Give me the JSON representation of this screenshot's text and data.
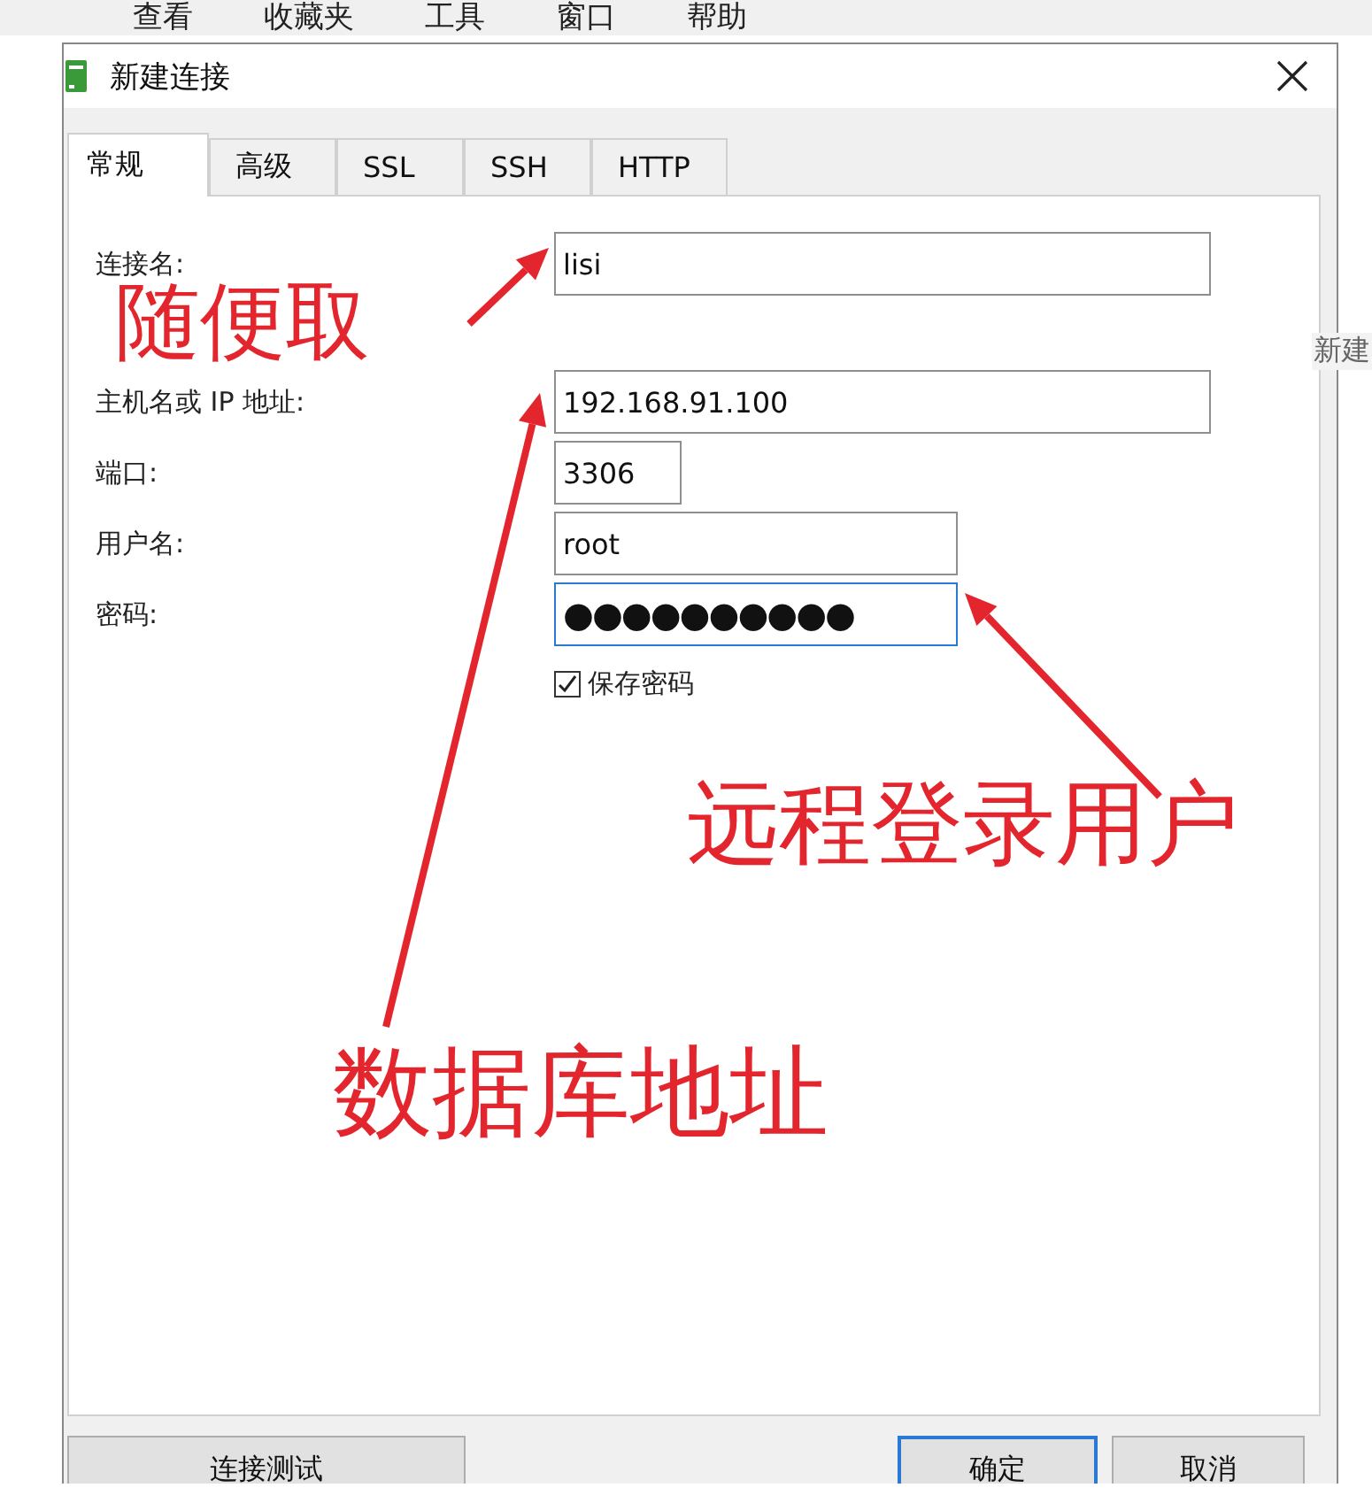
{
  "menu_bar": [
    {
      "label": "查看"
    },
    {
      "label": "收藏夹"
    },
    {
      "label": "工具"
    },
    {
      "label": "窗口"
    },
    {
      "label": "帮助"
    }
  ],
  "background_text": "新建",
  "dialog": {
    "title": "新建连接",
    "tabs": [
      {
        "label": "常规",
        "selected": true
      },
      {
        "label": "高级",
        "selected": false
      },
      {
        "label": "SSL",
        "selected": false
      },
      {
        "label": "SSH",
        "selected": false
      },
      {
        "label": "HTTP",
        "selected": false
      }
    ],
    "connection_name": {
      "label": "连接名:",
      "value": "lisi"
    },
    "fields": [
      {
        "label": "主机名或 IP 地址:",
        "value": "192.168.91.100",
        "kind": "text",
        "focused": false
      },
      {
        "label": "端口:",
        "value": "3306",
        "kind": "number",
        "focused": false
      },
      {
        "label": "用户名:",
        "value": "root",
        "kind": "user",
        "focused": false
      },
      {
        "label": "密码:",
        "value": "●●●●●●●●●●",
        "kind": "password",
        "focused": true
      }
    ],
    "save_password": {
      "label": "保存密码",
      "checked": true
    },
    "buttons": [
      {
        "label": "连接测试",
        "default": false
      },
      {
        "label": "确定",
        "default": true
      },
      {
        "label": "取消",
        "default": false
      }
    ]
  },
  "annotations": [
    {
      "text": "随便取"
    },
    {
      "text": "远程登录用户"
    },
    {
      "text": "数据库地址"
    }
  ]
}
